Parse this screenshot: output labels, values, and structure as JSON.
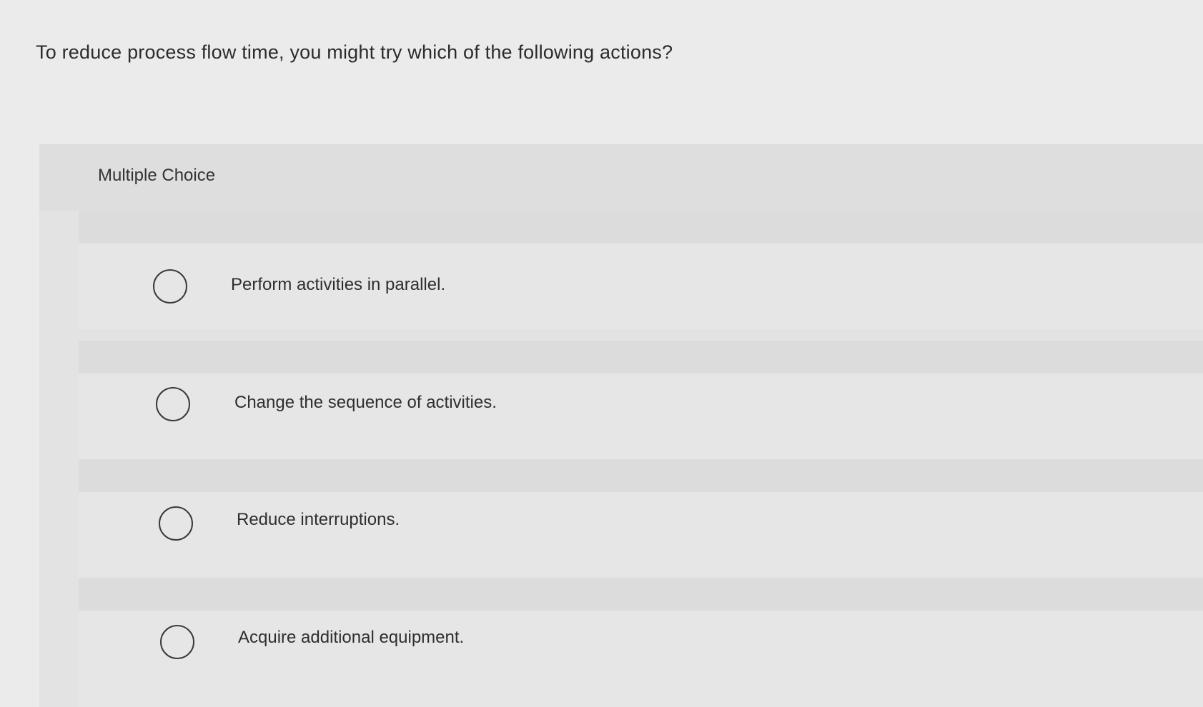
{
  "question": {
    "text": "To reduce process flow time, you might try which of the following actions?"
  },
  "multiple_choice": {
    "title": "Multiple Choice",
    "options": [
      {
        "label": "Perform activities in parallel.",
        "selected": false
      },
      {
        "label": "Change the sequence of activities.",
        "selected": false
      },
      {
        "label": "Reduce interruptions.",
        "selected": false
      },
      {
        "label": "Acquire additional equipment.",
        "selected": false
      }
    ]
  }
}
